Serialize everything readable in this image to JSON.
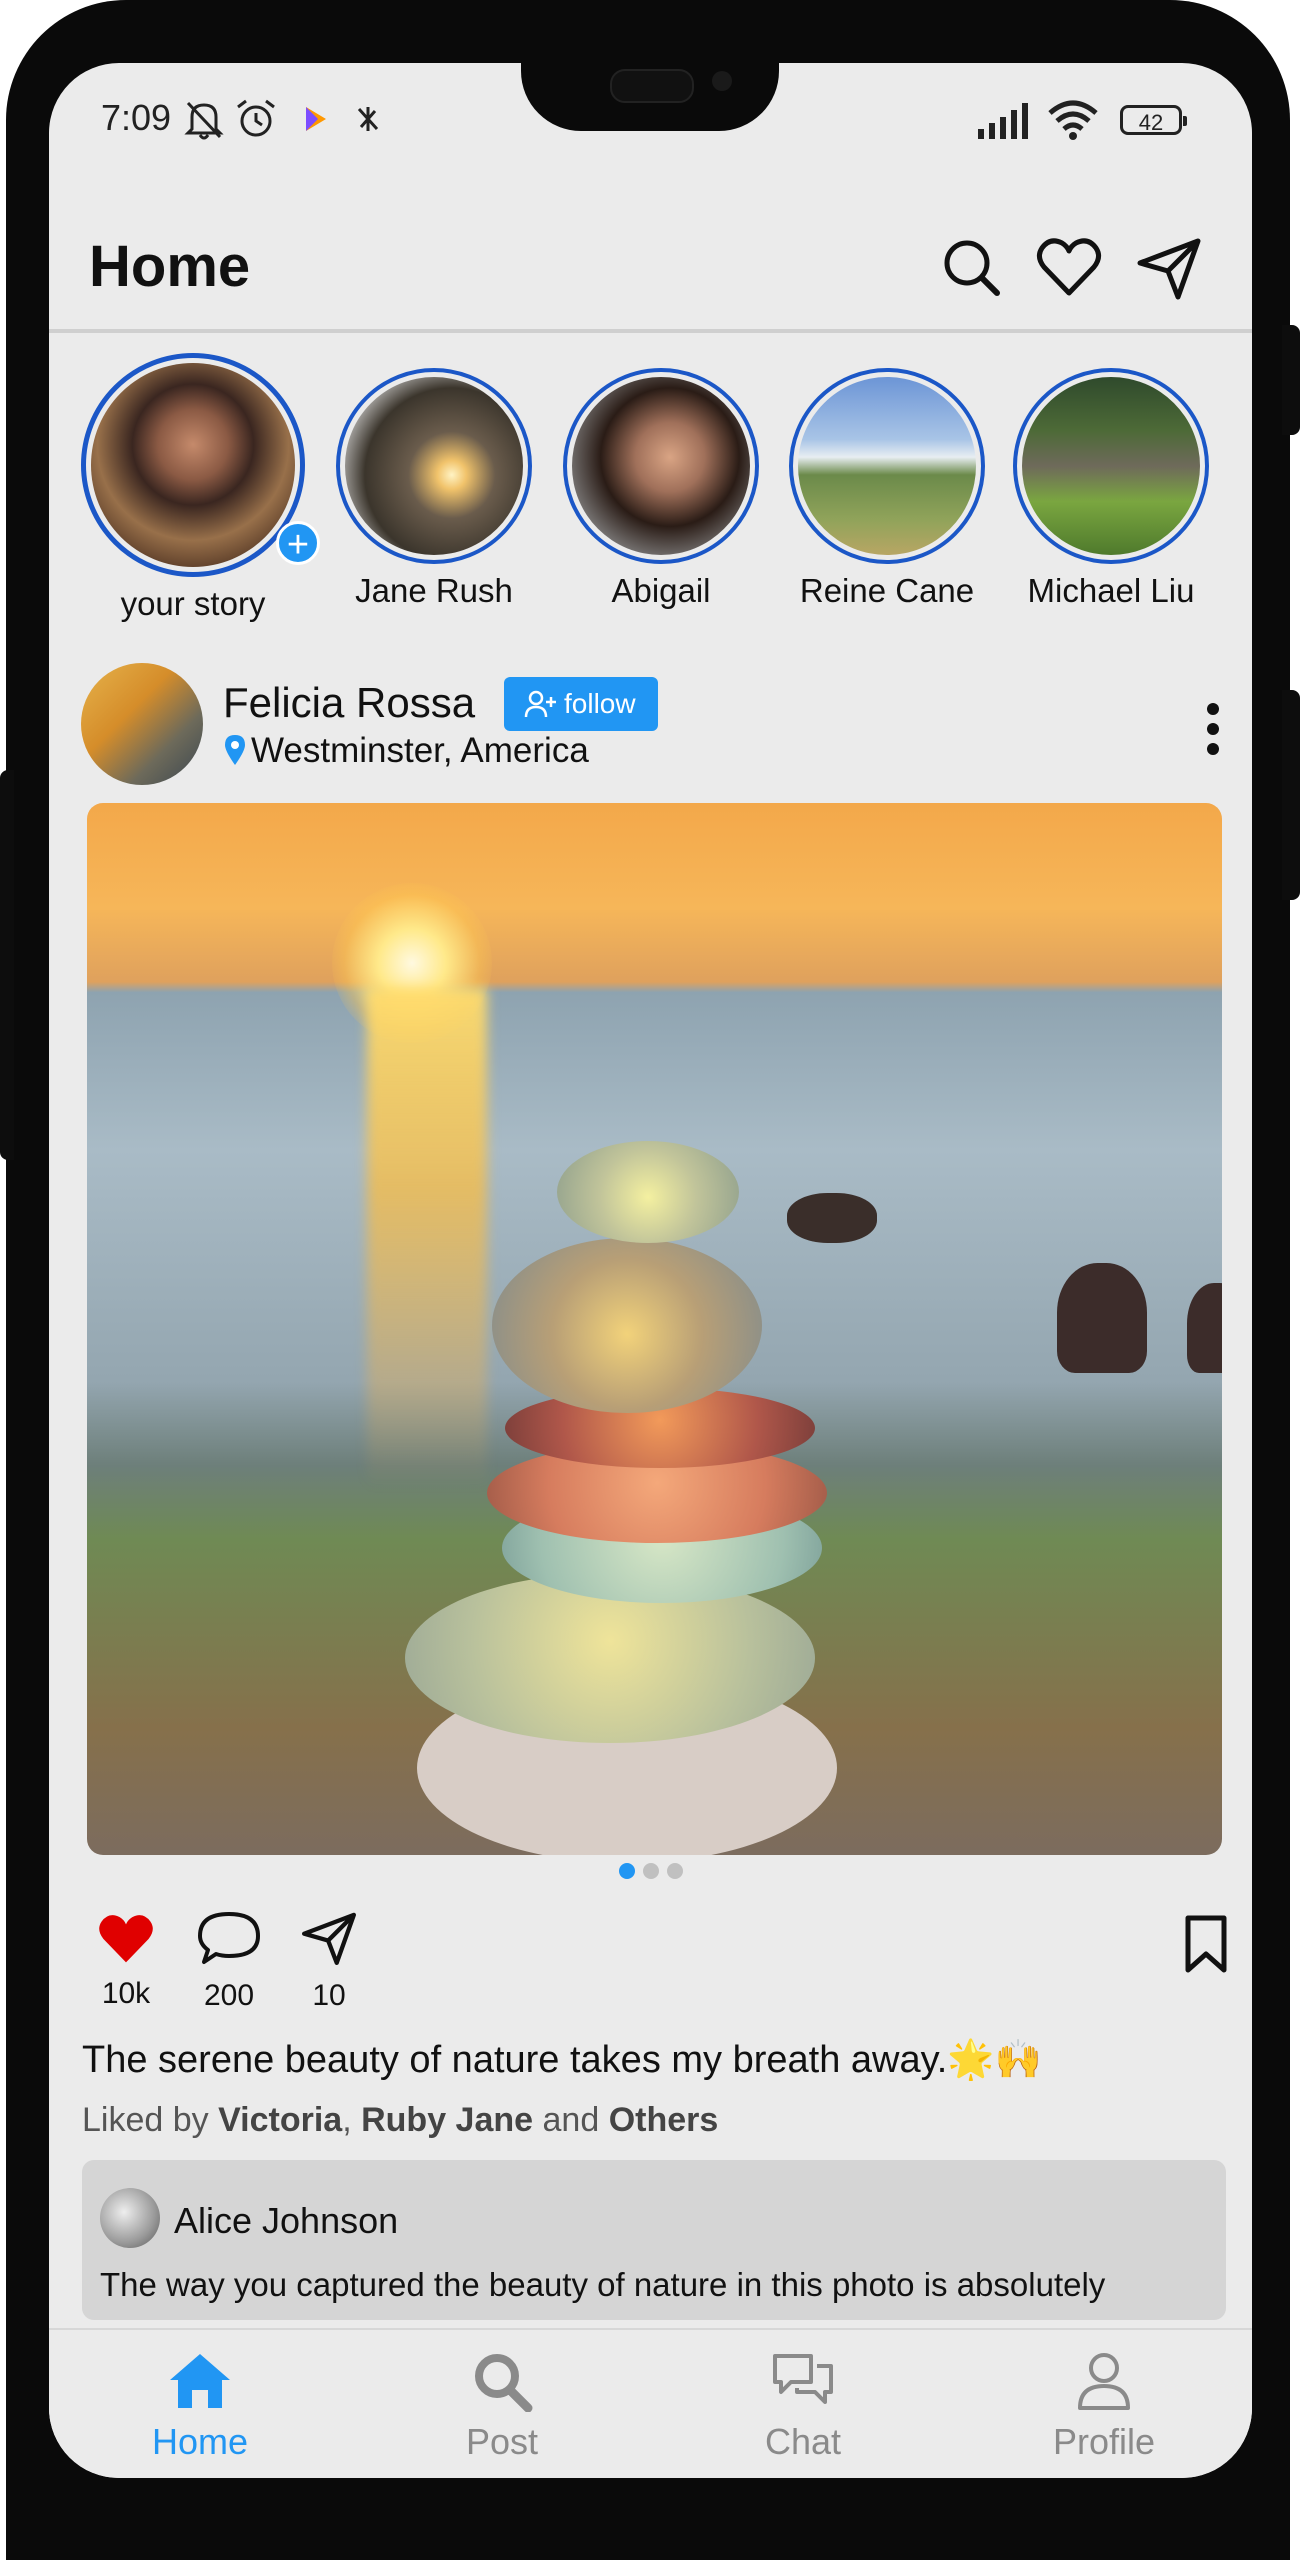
{
  "status": {
    "time": "7:09",
    "battery": "42"
  },
  "header": {
    "title": "Home"
  },
  "stories": [
    {
      "name": "your story"
    },
    {
      "name": "Jane Rush"
    },
    {
      "name": "Abigail"
    },
    {
      "name": "Reine Cane"
    },
    {
      "name": "Michael Liu"
    }
  ],
  "post": {
    "author": "Felicia Rossa",
    "follow_label": "follow",
    "location": "Westminster, America",
    "likes": "10k",
    "comments": "200",
    "shares": "10",
    "caption": "The serene beauty of nature takes my breath away.🌟🙌",
    "liked_by_prefix": "Liked by ",
    "liked_by_1": "Victoria",
    "liked_by_sep": ", ",
    "liked_by_2": "Ruby Jane",
    "liked_by_and": " and ",
    "liked_by_3": "Others"
  },
  "comment": {
    "author": "Alice Johnson",
    "text": "The way you captured the beauty of nature in this photo is absolutely"
  },
  "nav": {
    "home": "Home",
    "post": "Post",
    "chat": "Chat",
    "profile": "Profile"
  },
  "colors": {
    "accent": "#2196f3",
    "like": "#e00000",
    "ring": "#1b57c7"
  }
}
